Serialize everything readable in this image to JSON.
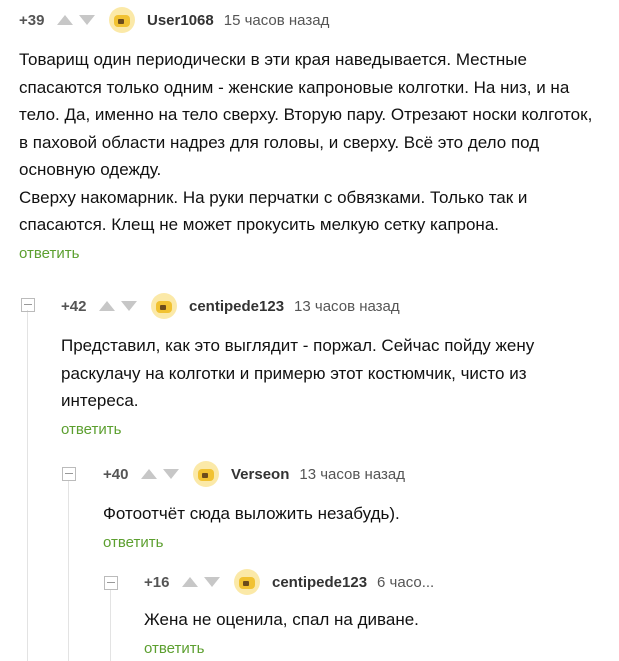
{
  "comments": [
    {
      "rating": "+39",
      "user": "User1068",
      "time": "15 часов назад",
      "text": "Товарищ один периодически в эти края наведывается. Местные спасаются только одним - женские капроновые колготки.  На низ, и на тело. Да, именно на тело сверху.  Вторую пару. Отрезают носки колготок, в паховой области надрез для головы, и сверху. Всё это дело под основную одежду.\nСверху накомарник. На руки перчатки с обвязками. Только так и спасаются. Клещ не может прокусить мелкую сетку капрона.",
      "reply": "ответить"
    },
    {
      "rating": "+42",
      "user": "centipede123",
      "time": "13 часов назад",
      "text": "Представил, как это выглядит - поржал. Сейчас пойду жену раскулачу на колготки и примерю этот костюмчик, чисто из интереса.",
      "reply": "ответить"
    },
    {
      "rating": "+40",
      "user": "Verseon",
      "time": "13 часов назад",
      "text": "Фотоотчёт сюда выложить незабудь).",
      "reply": "ответить"
    },
    {
      "rating": "+16",
      "user": "centipede123",
      "time": "6 часо...",
      "text": "Жена не оценила, спал на диване.",
      "reply": "ответить"
    }
  ]
}
